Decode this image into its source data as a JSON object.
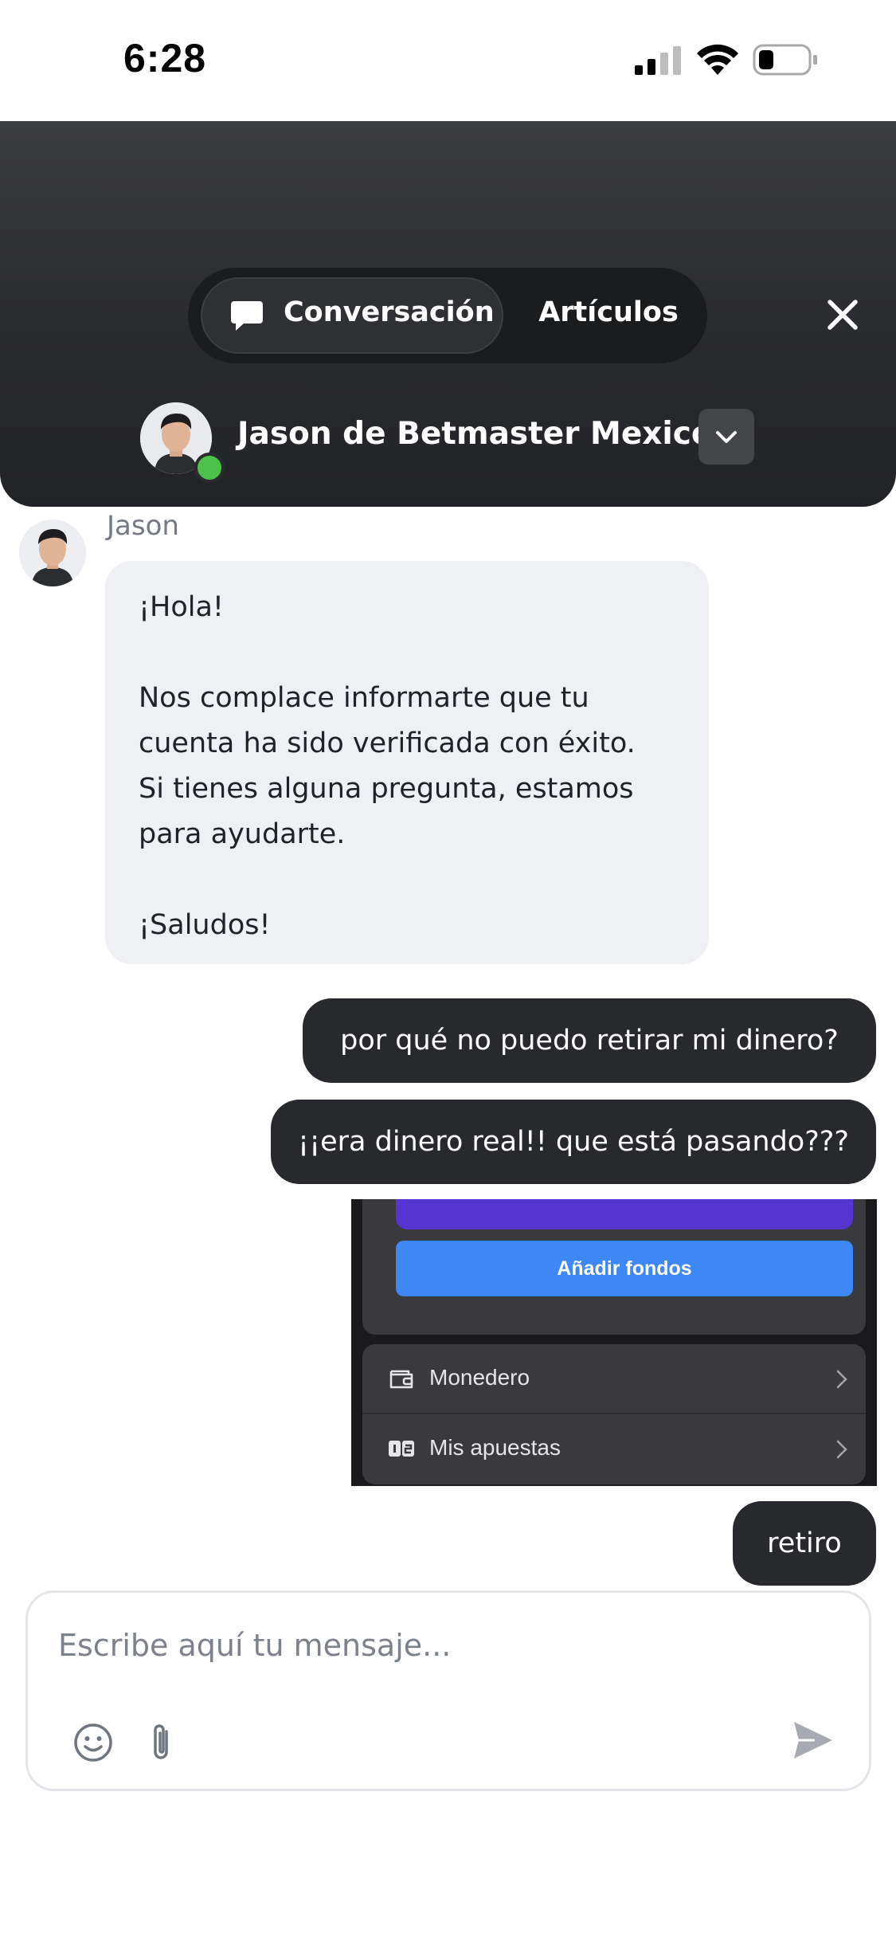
{
  "status_bar": {
    "time": "6:28"
  },
  "header": {
    "tabs": [
      {
        "label": "Conversación",
        "active": true,
        "icon": "chat-bubble-icon"
      },
      {
        "label": "Artículos",
        "active": false
      }
    ],
    "agent": {
      "name": "Jason de Betmaster Mexico",
      "online": true
    },
    "colors": {
      "header_bg": "#2c2d30",
      "online": "#4cc24a"
    }
  },
  "messages": [
    {
      "from": "agent",
      "sender": "Jason",
      "lines": [
        "¡Hola!",
        "",
        "Nos complace informarte que tu",
        "cuenta ha sido verificada con éxito.",
        "Si tienes alguna pregunta, estamos",
        "para ayudarte.",
        "",
        "¡Saludos!"
      ]
    },
    {
      "from": "user",
      "text": "por qué no puedo retirar mi dinero?"
    },
    {
      "from": "user",
      "text": "¡¡era dinero real!! que está pasando???"
    },
    {
      "from": "user",
      "type": "image",
      "image": {
        "button": "Añadir fondos",
        "rows": [
          {
            "label": "Monedero",
            "icon": "wallet-icon"
          },
          {
            "label": "Mis apuestas",
            "icon": "bets-icon"
          }
        ]
      }
    },
    {
      "from": "user",
      "text": "retiro"
    }
  ],
  "composer": {
    "placeholder": "Escribe aquí tu mensaje...",
    "value": ""
  }
}
